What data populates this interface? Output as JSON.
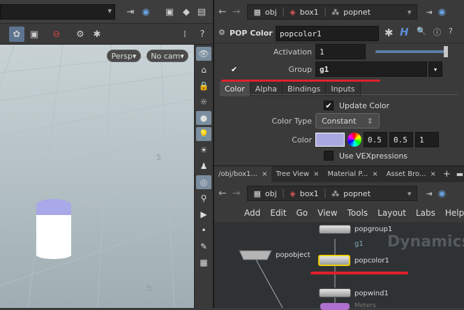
{
  "viewport": {
    "persp_label": "Persp",
    "cam_label": "No cam",
    "grid_labels": [
      "5",
      "-5"
    ]
  },
  "parm_pane": {
    "path": [
      "obj",
      "box1",
      "popnet"
    ],
    "node_type": "POP Color",
    "node_name": "popcolor1",
    "activation_label": "Activation",
    "activation_value": "1",
    "group_label": "Group",
    "group_value": "g1",
    "tabs": [
      "Color",
      "Alpha",
      "Bindings",
      "Inputs"
    ],
    "update_color_label": "Update Color",
    "color_type_label": "Color Type",
    "color_type_value": "Constant",
    "color_label": "Color",
    "color_values": [
      "0.5",
      "0.5",
      "1"
    ],
    "use_vex_label": "Use VEXpressions"
  },
  "net_pane": {
    "tabs": [
      "/obj/box1...",
      "Tree View",
      "Material P...",
      "Asset Bro..."
    ],
    "path": [
      "obj",
      "box1",
      "popnet"
    ],
    "menu": [
      "Add",
      "Edit",
      "Go",
      "View",
      "Tools",
      "Layout",
      "Labs",
      "Help"
    ],
    "watermark": "Dynamics",
    "nodes": [
      {
        "name": "popgroup1",
        "sub": "g1"
      },
      {
        "name": "popcolor1"
      },
      {
        "name": "popwind1",
        "sub": "Meters"
      },
      {
        "name": "popobject"
      }
    ]
  },
  "colors": {
    "swatch": "#a9a8e0",
    "annotation": "#e0202a",
    "selected_node": "#f0d000"
  }
}
